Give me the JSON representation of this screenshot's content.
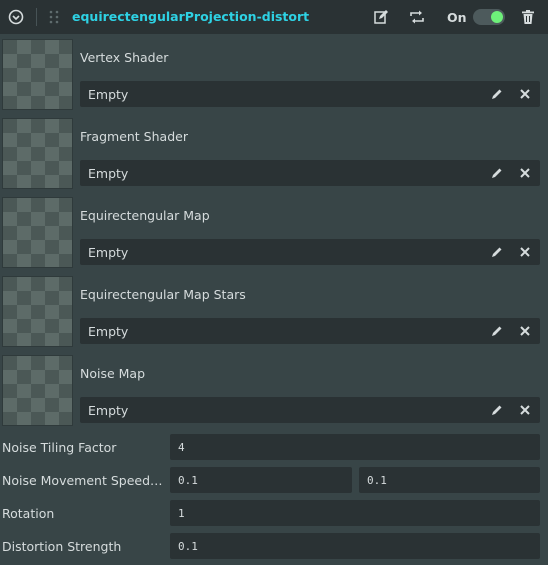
{
  "header": {
    "title": "equirectengularProjection-distort",
    "toggle_label": "On",
    "toggle_state": true,
    "accent_color": "#2ed2e4",
    "switch_color": "#6ef07a",
    "icons": [
      "collapse-circle-icon",
      "drag-grip-icon",
      "edit-icon",
      "swap-icon",
      "trash-icon"
    ]
  },
  "textures": [
    {
      "label": "Vertex Shader",
      "value": "Empty"
    },
    {
      "label": "Fragment Shader",
      "value": "Empty"
    },
    {
      "label": "Equirectengular Map",
      "value": "Empty"
    },
    {
      "label": "Equirectengular Map Stars",
      "value": "Empty"
    },
    {
      "label": "Noise Map",
      "value": "Empty"
    }
  ],
  "properties": {
    "noise_tiling_factor": {
      "label": "Noise Tiling Factor",
      "value": "4"
    },
    "noise_movement_speed": {
      "label": "Noise Movement Speed (...",
      "x": "0.1",
      "y": "0.1"
    },
    "rotation": {
      "label": "Rotation",
      "value": "1"
    },
    "distortion_strength": {
      "label": "Distortion Strength",
      "value": "0.1"
    }
  }
}
